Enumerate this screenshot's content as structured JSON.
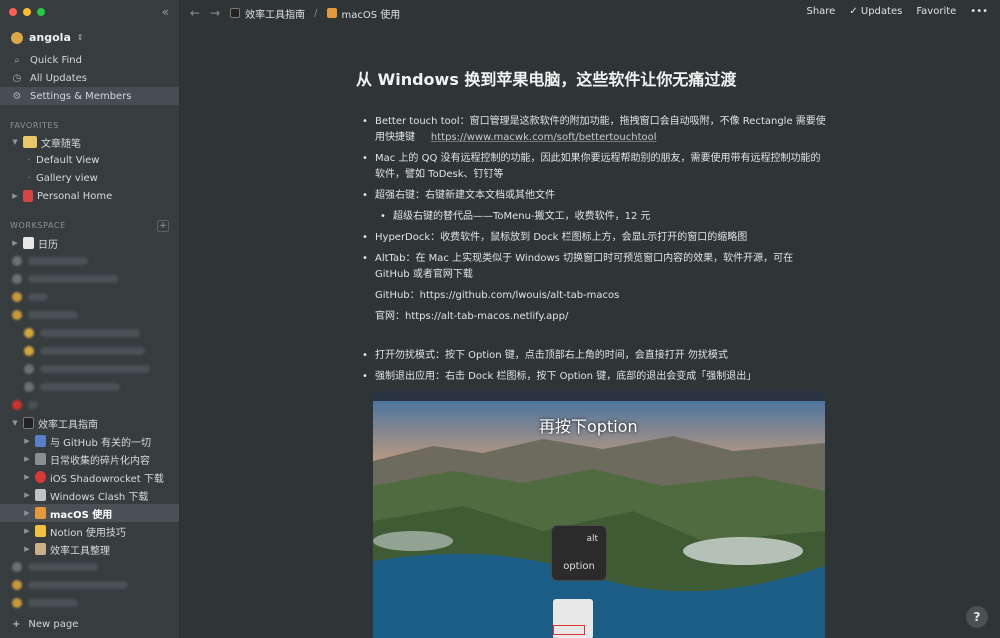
{
  "sidebar": {
    "workspace_name": "angola",
    "nav": [
      {
        "label": "Quick Find",
        "icon": "search-icon"
      },
      {
        "label": "All Updates",
        "icon": "clock-icon"
      },
      {
        "label": "Settings & Members",
        "icon": "gear-icon"
      }
    ],
    "favorites_title": "FAVORITES",
    "favorites": [
      {
        "label": "文章随笔",
        "level": 0,
        "caret": "▼"
      },
      {
        "label": "Default View",
        "level": 1
      },
      {
        "label": "Gallery view",
        "level": 1
      },
      {
        "label": "Personal Home",
        "level": 0,
        "caret": "▶"
      }
    ],
    "workspace_title": "WORKSPACE",
    "workspace_top": {
      "label": "日历",
      "caret": "▶"
    },
    "workspace_main": {
      "label": "效率工具指南",
      "caret": "▼"
    },
    "workspace_children": [
      {
        "label": "与 GitHub 有关的一切"
      },
      {
        "label": "日常收集的碎片化内容"
      },
      {
        "label": "iOS Shadowrocket 下载"
      },
      {
        "label": "Windows Clash 下载"
      },
      {
        "label": "macOS 使用",
        "active": true
      },
      {
        "label": "Notion 使用技巧"
      },
      {
        "label": "效率工具整理"
      }
    ],
    "new_page": "New page"
  },
  "topbar": {
    "breadcrumb_1": "效率工具指南",
    "breadcrumb_sep": "/",
    "breadcrumb_2": "macOS 使用",
    "share": "Share",
    "updates": "Updates",
    "favorite": "Favorite",
    "more": "•••"
  },
  "doc": {
    "title": "从 Windows 换到苹果电脑，这些软件让你无痛过渡",
    "items": {
      "b1_text": "Better touch tool：窗口管理是这款软件的附加功能，拖拽窗口会自动吸附，不像 Rectangle 需要使用快捷键",
      "b1_link": "https://www.macwk.com/soft/bettertouchtool",
      "b2": "Mac 上的 QQ 没有远程控制的功能，因此如果你要远程帮助别的朋友，需要使用带有远程控制功能的软件，譬如 ToDesk、钉钉等",
      "b3": "超强右键：右键新建文本文档或其他文件",
      "b3_sub": "超级右键的替代品——ToMenu-搬文工，收费软件，12 元",
      "b4": "HyperDock：收费软件，鼠标放到 Dock 栏图标上方，会显L示打开的窗口的缩略图",
      "b5": "AltTab：在 Mac 上实现类似于 Windows 切换窗口时可预览窗口内容的效果，软件开源，可在 GitHub 或者官网下载",
      "p1": "GitHub：https://github.com/lwouis/alt-tab-macos",
      "p2": "官网：https://alt-tab-macos.netlify.app/",
      "b6": "打开勿扰模式：按下 Option 键，点击顶部右上角的时间，会直接打开 勿扰模式",
      "b7": "强制退出应用：右击 Dock 栏图标，按下 Option 键，底部的退出会变成「强制退出」"
    },
    "screenshot": {
      "caption": "再按下option",
      "key_top": "alt",
      "key_bottom": "option"
    }
  },
  "help": "?"
}
